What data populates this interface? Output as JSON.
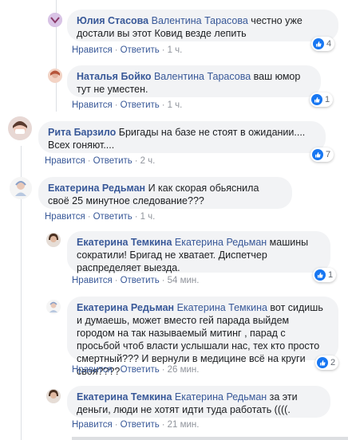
{
  "actions": {
    "like": "Нравится",
    "reply": "Ответить",
    "separator": "·"
  },
  "colors": {
    "link": "#385898",
    "bubble": "#f2f3f5",
    "like_badge": "#1877f2"
  },
  "comments": [
    {
      "author": "Юлия Стасова",
      "mention": "Валентина Тарасова",
      "text": " честно уже достали вы этот Ковид везде лепить",
      "time": "1 ч.",
      "likes": "4",
      "avatar_icon": "user-avatar"
    },
    {
      "author": "Наталья Бойко",
      "mention": "Валентина Тарасова",
      "text": " ваш юмор тут не уместен.",
      "time": "1 ч.",
      "likes": "1",
      "avatar_icon": "user-avatar"
    },
    {
      "author": "Рита Барзило",
      "mention": "",
      "text": " Бригады на базе не стоят в ожидании.... Всех гоняют....",
      "time": "2 ч.",
      "likes": "7",
      "avatar_icon": "user-avatar"
    },
    {
      "author": "Екатерина Редьман",
      "mention": "",
      "text": " И как скорая обьяснила своё 25 минутное следование???",
      "time": "1 ч.",
      "likes": "",
      "avatar_icon": "user-avatar"
    },
    {
      "author": "Екатерина Темкина",
      "mention": "Екатерина Редьман",
      "text": " машины сократили! Бригад не хватает. Диспетчер распределяет выезда.",
      "time": "54 мин.",
      "likes": "1",
      "avatar_icon": "user-avatar"
    },
    {
      "author": "Екатерина Редьман",
      "mention": "Екатерина Темкина",
      "text": " вот сидишь и думаешь, может вместо гей парада выйдем городом на так называемый митинг , парад с просьбой чтоб власти услышали нас, тех кто просто смертный??? И вернули в медицине всё на круги своя????",
      "time": "26 мин.",
      "likes": "2",
      "avatar_icon": "user-avatar"
    },
    {
      "author": "Екатерина Темкина",
      "mention": "Екатерина Редьман",
      "text": " за эти деньги, люди не хотят идти туда работать ((((.",
      "time": "21 мин.",
      "likes": "",
      "avatar_icon": "user-avatar"
    }
  ]
}
